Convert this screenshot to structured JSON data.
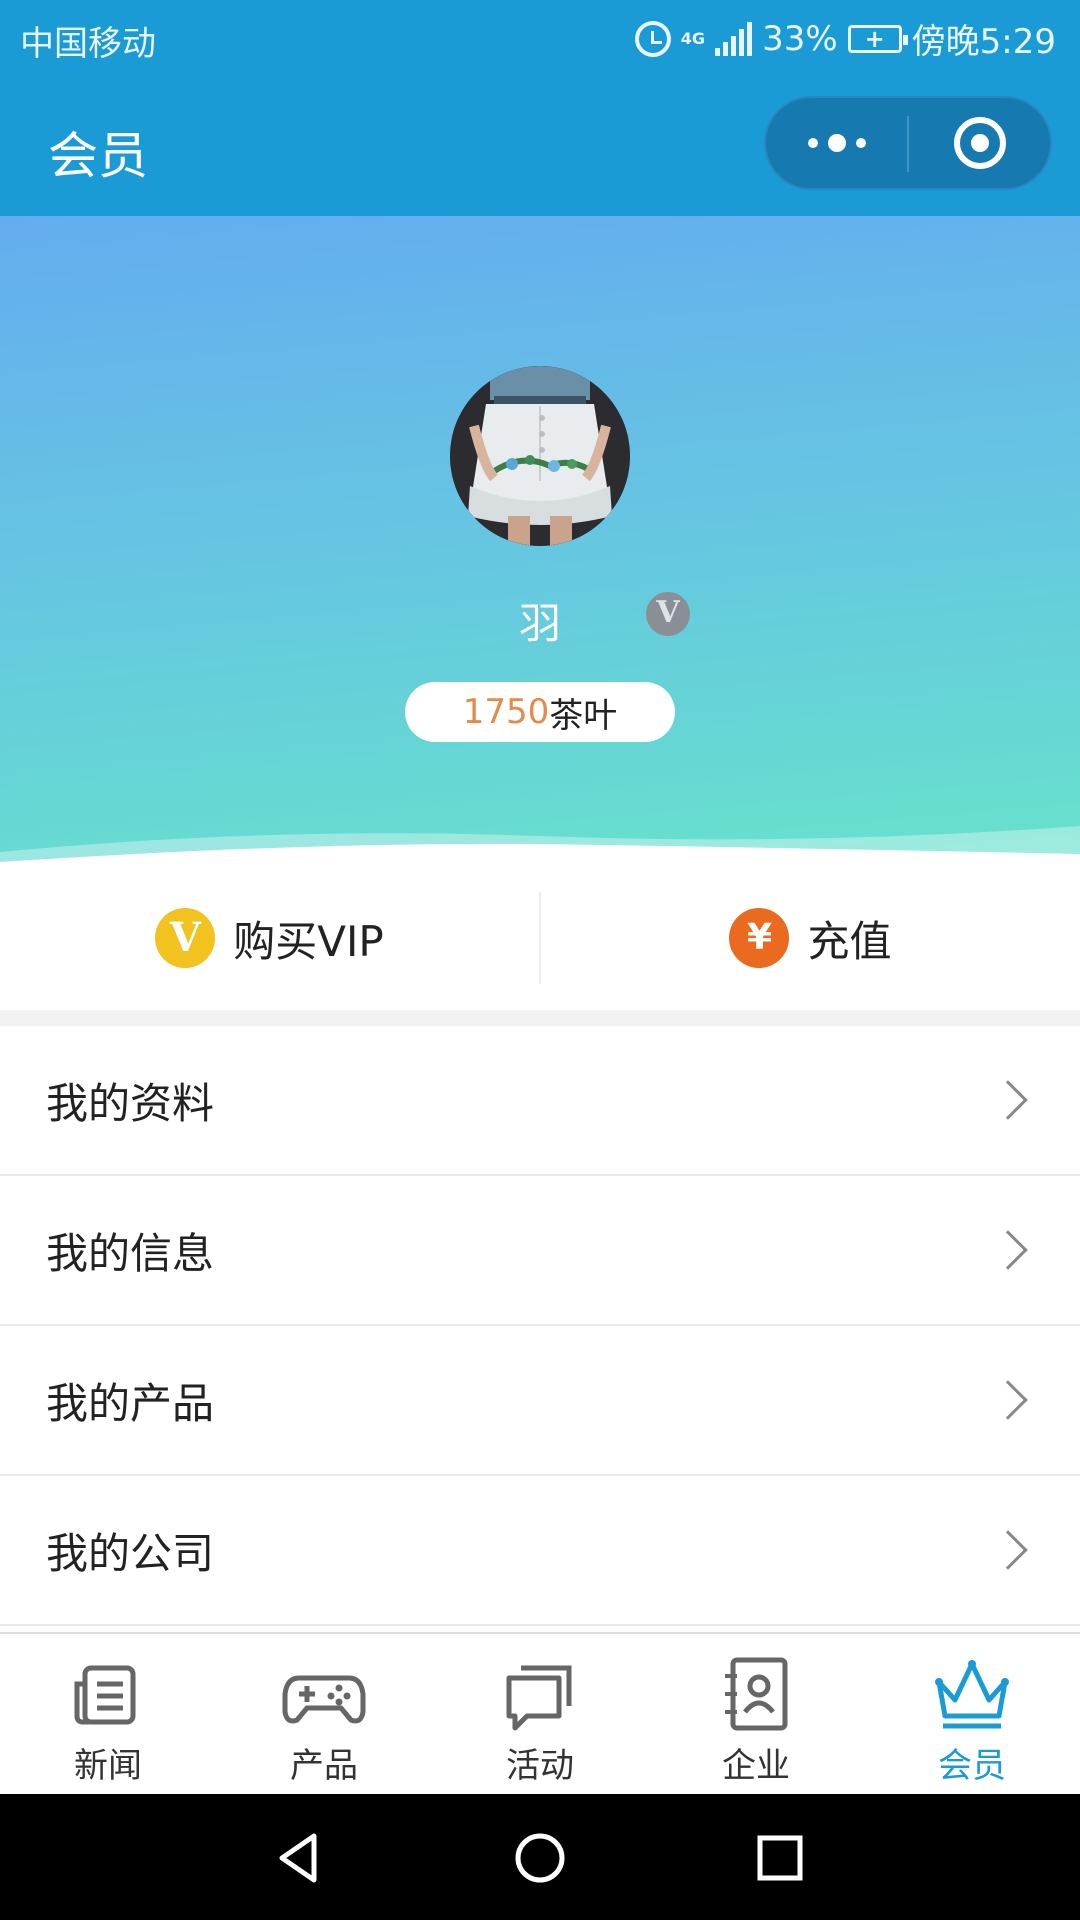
{
  "status_bar": {
    "carrier": "中国移动",
    "network": "4G",
    "battery": "33%",
    "time": "傍晚5:29"
  },
  "nav": {
    "title": "会员",
    "more_icon": "more-dots-icon",
    "close_icon": "target-circle-icon"
  },
  "profile": {
    "name": "羽",
    "vip_badge": "V",
    "points_value": "1750",
    "points_unit": "茶叶"
  },
  "actions": [
    {
      "label": "购买VIP",
      "icon": "vip-icon",
      "icon_text": "V",
      "color": "#f2c21e"
    },
    {
      "label": "充值",
      "icon": "yuan-icon",
      "icon_text": "¥",
      "color": "#ea6a1f"
    }
  ],
  "menu": [
    {
      "label": "我的资料"
    },
    {
      "label": "我的信息"
    },
    {
      "label": "我的产品"
    },
    {
      "label": "我的公司"
    }
  ],
  "tabs": [
    {
      "label": "新闻",
      "icon": "news-icon",
      "active": false
    },
    {
      "label": "产品",
      "icon": "gamepad-icon",
      "active": false
    },
    {
      "label": "活动",
      "icon": "chat-icon",
      "active": false
    },
    {
      "label": "企业",
      "icon": "contact-card-icon",
      "active": false
    },
    {
      "label": "会员",
      "icon": "crown-icon",
      "active": true
    }
  ],
  "colors": {
    "primary": "#1a9bd6",
    "points": "#e38c4a"
  }
}
